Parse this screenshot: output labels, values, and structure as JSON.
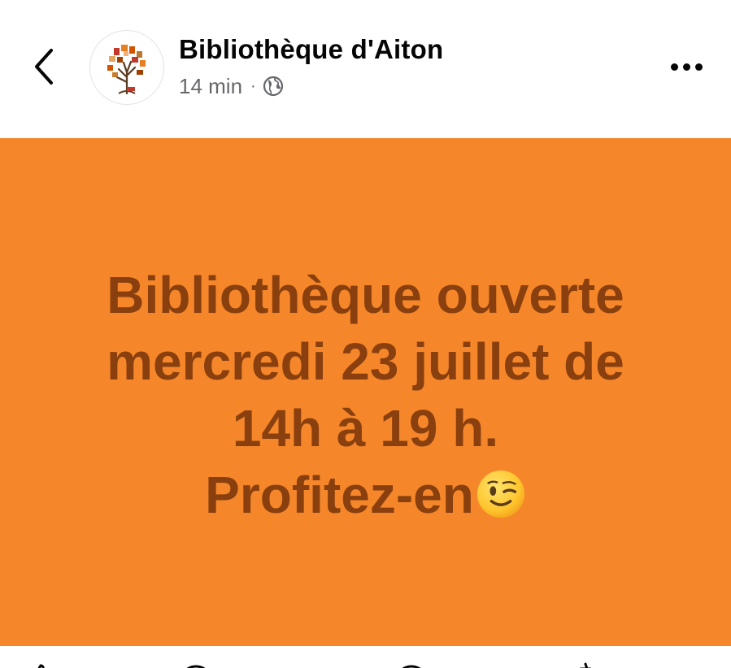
{
  "header": {
    "back_icon": "chevron-left-icon",
    "page_name": "Bibliothèque d'Aiton",
    "time": "14 min",
    "separator": "·",
    "audience_icon": "globe-icon",
    "more_icon": "more-horizontal-icon"
  },
  "post": {
    "background_color": "#f5872a",
    "text_color": "#8a3f0e",
    "lines": [
      "Bibliothèque ouverte",
      "mercredi 23 juillet de",
      "14h à 19 h.",
      "Profitez-en"
    ],
    "emoji": "winking-face"
  },
  "actions": {
    "icons": [
      "like-icon",
      "comment-icon",
      "send-icon",
      "share-icon"
    ]
  }
}
